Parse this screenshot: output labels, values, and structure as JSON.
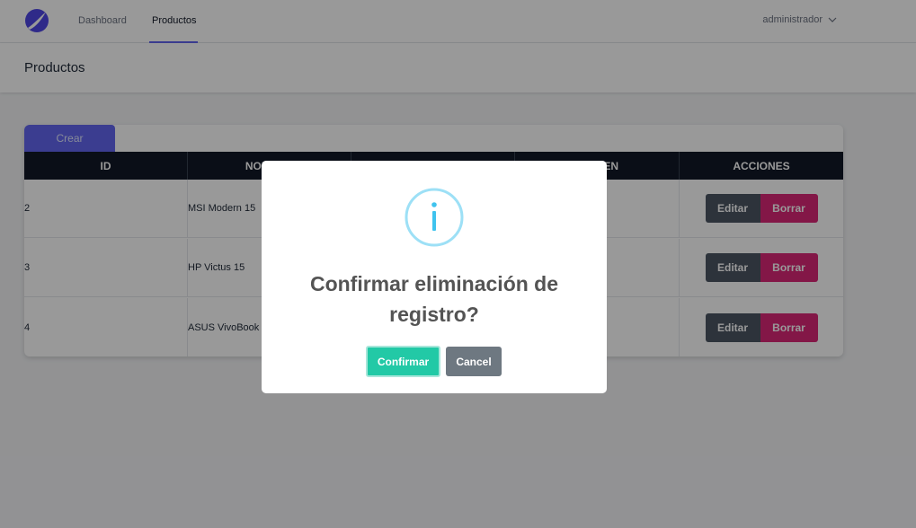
{
  "navbar": {
    "links": [
      {
        "label": "Dashboard",
        "active": false
      },
      {
        "label": "Productos",
        "active": true
      }
    ],
    "user": {
      "name": "administrador",
      "icon": "chevron-down-icon"
    },
    "logo_color": "#4f46e5"
  },
  "page": {
    "title": "Productos"
  },
  "table": {
    "create_label": "Crear",
    "headers": [
      "ID",
      "NOMBRE",
      "",
      "IMAGEN",
      "ACCIONES"
    ],
    "rows": [
      {
        "id": "2",
        "name": "MSI Modern 15"
      },
      {
        "id": "3",
        "name": "HP Victus 15"
      },
      {
        "id": "4",
        "name": "ASUS VivoBook"
      }
    ],
    "edit_label": "Editar",
    "delete_label": "Borrar"
  },
  "modal": {
    "icon": "info-icon",
    "title": "Confirmar eliminación de registro?",
    "confirm_label": "Confirmar",
    "cancel_label": "Cancel",
    "accent": "#22c9a6"
  }
}
